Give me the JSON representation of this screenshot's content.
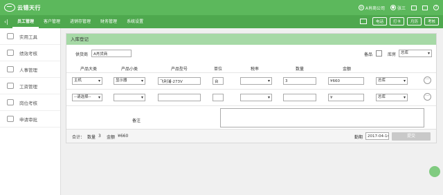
{
  "header": {
    "logo_text": "云错天行",
    "company": "A肖商公司",
    "user": "张三"
  },
  "nav": {
    "items": [
      "员工管理",
      "客户管理",
      "进销存管理",
      "财务管理",
      "系统设置"
    ],
    "buttons": [
      "电话",
      "打卡",
      "月历",
      "考核"
    ]
  },
  "sidebar": {
    "items": [
      "实用工具",
      "绩效考核",
      "人事管理",
      "工资管理",
      "岗位考核",
      "申请审批"
    ]
  },
  "panel": {
    "title": "入库登记",
    "supplier_label": "供货商",
    "supplier_value": "A肖货商",
    "spare_label": "备品",
    "warehouse_label": "库房",
    "warehouse_value": "总库"
  },
  "table": {
    "columns": [
      "产品大类",
      "产品小类",
      "产品型号",
      "单位",
      "税率",
      "数量",
      "金额"
    ],
    "rows": [
      {
        "category": "主机",
        "subcategory": "显示器",
        "model": "飞利浦-273V",
        "unit": "台",
        "tax": "",
        "qty": "3",
        "amount": "¥660",
        "warehouse": "总库"
      },
      {
        "category": "--请选择--",
        "subcategory": "",
        "model": "",
        "unit": "",
        "tax": "",
        "qty": "",
        "amount": "¥",
        "warehouse": "总库"
      }
    ],
    "more_symbol": "···"
  },
  "remark": {
    "label": "备注"
  },
  "footer": {
    "total_label": "合计：",
    "qty_label": "数量",
    "qty_value": "3",
    "amount_label": "金额",
    "amount_value": "¥660",
    "date_label": "勤期",
    "date_value": "2017-04-14",
    "submit_label": "提交"
  }
}
